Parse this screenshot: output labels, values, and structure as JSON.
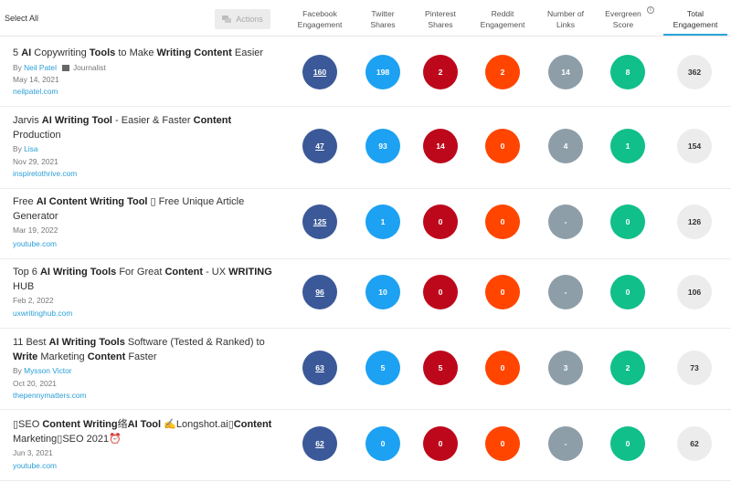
{
  "header": {
    "select_all": "Select All",
    "actions_label": "Actions",
    "columns": [
      {
        "l1": "Facebook",
        "l2": "Engagement"
      },
      {
        "l1": "Twitter",
        "l2": "Shares"
      },
      {
        "l1": "Pinterest",
        "l2": "Shares"
      },
      {
        "l1": "Reddit",
        "l2": "Engagement"
      },
      {
        "l1": "Number of",
        "l2": "Links"
      },
      {
        "l1": "Evergreen",
        "l2": "Score"
      },
      {
        "l1": "Total",
        "l2": "Engagement"
      }
    ],
    "info_glyph": "i"
  },
  "rows": [
    {
      "title_line1": [
        "5 ",
        "AI",
        " Copywriting ",
        "Tools",
        " to Make ",
        "Writing Content",
        " Easier"
      ],
      "by": "By",
      "author": "Neil Patel",
      "role": "Journalist",
      "date": "May 14, 2021",
      "domain": "neilpatel.com",
      "facebook": "160",
      "twitter": "198",
      "pinterest": "2",
      "reddit": "2",
      "links": "14",
      "evergreen": "8",
      "total": "362"
    },
    {
      "title_line1": [
        "Jarvis ",
        "AI Writing Tool",
        " - Easier & Faster ",
        "Content"
      ],
      "title_line2": [
        "Production"
      ],
      "by": "By",
      "author": "Lisa",
      "date": "Nov 29, 2021",
      "domain": "inspiretothrive.com",
      "facebook": "47",
      "twitter": "93",
      "pinterest": "14",
      "reddit": "0",
      "links": "4",
      "evergreen": "1",
      "total": "154"
    },
    {
      "title_line1": [
        "Free ",
        "AI Content Writing Tool",
        " ▯ Free Unique Article"
      ],
      "title_line2": [
        "Generator"
      ],
      "date": "Mar 19, 2022",
      "domain": "youtube.com",
      "facebook": "125",
      "twitter": "1",
      "pinterest": "0",
      "reddit": "0",
      "links": "-",
      "evergreen": "0",
      "total": "126"
    },
    {
      "title_line1": [
        "Top 6 ",
        "AI Writing Tools",
        " For Great ",
        "Content",
        " - UX ",
        "WRITING"
      ],
      "title_line2": [
        "HUB"
      ],
      "date": "Feb 2, 2022",
      "domain": "uxwritinghub.com",
      "facebook": "96",
      "twitter": "10",
      "pinterest": "0",
      "reddit": "0",
      "links": "-",
      "evergreen": "0",
      "total": "106"
    },
    {
      "title_line1": [
        "11 Best ",
        "AI Writing Tools",
        " Software (Tested & Ranked) to"
      ],
      "title_line2": [
        "Write",
        " Marketing ",
        "Content",
        " Faster"
      ],
      "by": "By",
      "author": "Mysson Victor",
      "date": "Oct 20, 2021",
      "domain": "thepennymatters.com",
      "facebook": "63",
      "twitter": "5",
      "pinterest": "5",
      "reddit": "0",
      "links": "3",
      "evergreen": "2",
      "total": "73"
    },
    {
      "title_line1": [
        "▯SEO ",
        "Content Writing",
        "络",
        "AI Tool",
        " ✍️Longshot.ai▯",
        "Content"
      ],
      "title_line2": [
        "Marketing▯SEO 2021⏰"
      ],
      "date": "Jun 3, 2021",
      "domain": "youtube.com",
      "facebook": "62",
      "twitter": "0",
      "pinterest": "0",
      "reddit": "0",
      "links": "-",
      "evergreen": "0",
      "total": "62"
    }
  ]
}
